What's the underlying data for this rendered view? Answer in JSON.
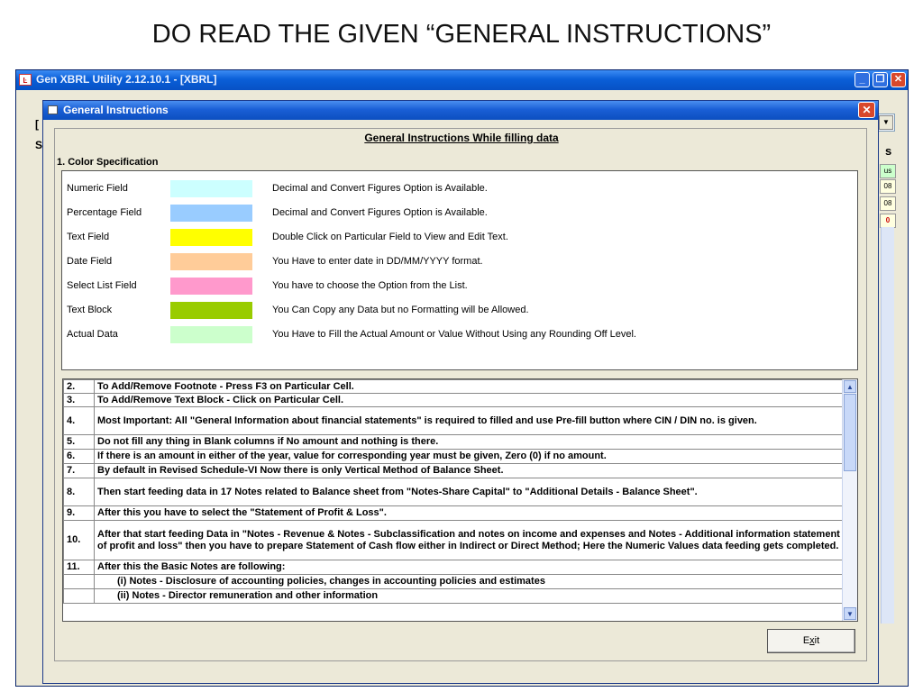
{
  "slide": {
    "title": "DO READ THE GIVEN “GENERAL INSTRUCTIONS”"
  },
  "app": {
    "title": "Gen XBRL Utility 2.12.10.1 - [XBRL]",
    "controls": {
      "minimize": "_",
      "maximize": "❐",
      "close": "✕"
    },
    "background": {
      "left_letters": [
        "[",
        "S"
      ],
      "right_letter": "s",
      "cells": [
        "us",
        "08",
        "08",
        "0"
      ]
    }
  },
  "dialog": {
    "title": "General Instructions",
    "close": "✕",
    "heading": "General Instructions While filling data",
    "section1_title": "1. Color Specification",
    "color_rows": [
      {
        "label": "Numeric Field",
        "color": "#ccffff",
        "description": "Decimal and Convert Figures Option is Available."
      },
      {
        "label": "Percentage Field",
        "color": "#99ccff",
        "description": "Decimal and Convert Figures Option is Available."
      },
      {
        "label": "Text Field",
        "color": "#ffff00",
        "description": "Double Click on Particular Field to View and Edit Text."
      },
      {
        "label": "Date Field",
        "color": "#ffcc99",
        "description": "You Have to enter date in DD/MM/YYYY format."
      },
      {
        "label": "Select List Field",
        "color": "#ff99cc",
        "description": "You have to choose the Option from the List."
      },
      {
        "label": "Text Block",
        "color": "#99cc00",
        "description": "You Can Copy any Data but no Formatting will be Allowed."
      },
      {
        "label": "Actual Data",
        "color": "#ccffcc",
        "description": "You Have to Fill the Actual Amount or Value Without Using any Rounding Off Level."
      }
    ],
    "instructions": [
      {
        "num": "2.",
        "text": "To Add/Remove Footnote - Press F3 on Particular Cell."
      },
      {
        "num": "3.",
        "text": "To Add/Remove Text Block - Click on Particular Cell."
      },
      {
        "num": "4.",
        "text": "Most Important: All \"General Information about financial statements\" is required to filled and use Pre-fill button where CIN / DIN no. is given."
      },
      {
        "num": "5.",
        "text": "Do not fill any thing in Blank columns if No amount and nothing is there."
      },
      {
        "num": "6.",
        "text": "If there is an amount in either of the year, value for corresponding year must be given, Zero (0) if no amount."
      },
      {
        "num": "7.",
        "text": "By default in Revised Schedule-VI Now there is only Vertical Method of Balance Sheet."
      },
      {
        "num": "8.",
        "text": "Then start feeding data in 17 Notes related to Balance sheet from \"Notes-Share Capital\" to \"Additional Details - Balance Sheet\"."
      },
      {
        "num": "9.",
        "text": "After this you have to select the \"Statement of Profit & Loss\"."
      },
      {
        "num": "10.",
        "text": "After that start feeding Data in \"Notes - Revenue & Notes - Subclassification and notes on income and expenses and Notes - Additional information statement of profit and loss\" then you have to prepare Statement of Cash flow either in Indirect or Direct Method; Here the Numeric Values data feeding gets completed."
      },
      {
        "num": "11.",
        "text": "After this the Basic Notes are following:"
      },
      {
        "num": "",
        "text": "(i)  Notes - Disclosure of accounting policies, changes in accounting policies and estimates"
      },
      {
        "num": "",
        "text": "(ii)  Notes - Director remuneration and other information"
      }
    ],
    "scroll": {
      "up": "▲",
      "down": "▼"
    },
    "exit_button": {
      "pre": "E",
      "accel": "x",
      "post": "it"
    }
  }
}
